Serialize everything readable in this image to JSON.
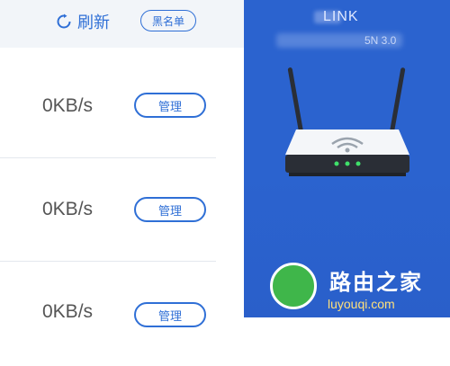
{
  "toolbar": {
    "refresh_label": "刷新",
    "blacklist_label": "黑名单"
  },
  "devices": [
    {
      "speed": "0KB/s",
      "manage_label": "管理"
    },
    {
      "speed": "0KB/s",
      "manage_label": "管理"
    },
    {
      "speed": "0KB/s",
      "manage_label": "管理"
    }
  ],
  "router_panel": {
    "brand": "LINK",
    "model": "5N 3.0",
    "bg_color": "#2b63cf"
  },
  "watermark": {
    "text": "路由之家",
    "sub": "luyouqi.com"
  },
  "colors": {
    "accent": "#2f6fd6",
    "status_light": "#3fe06a"
  }
}
